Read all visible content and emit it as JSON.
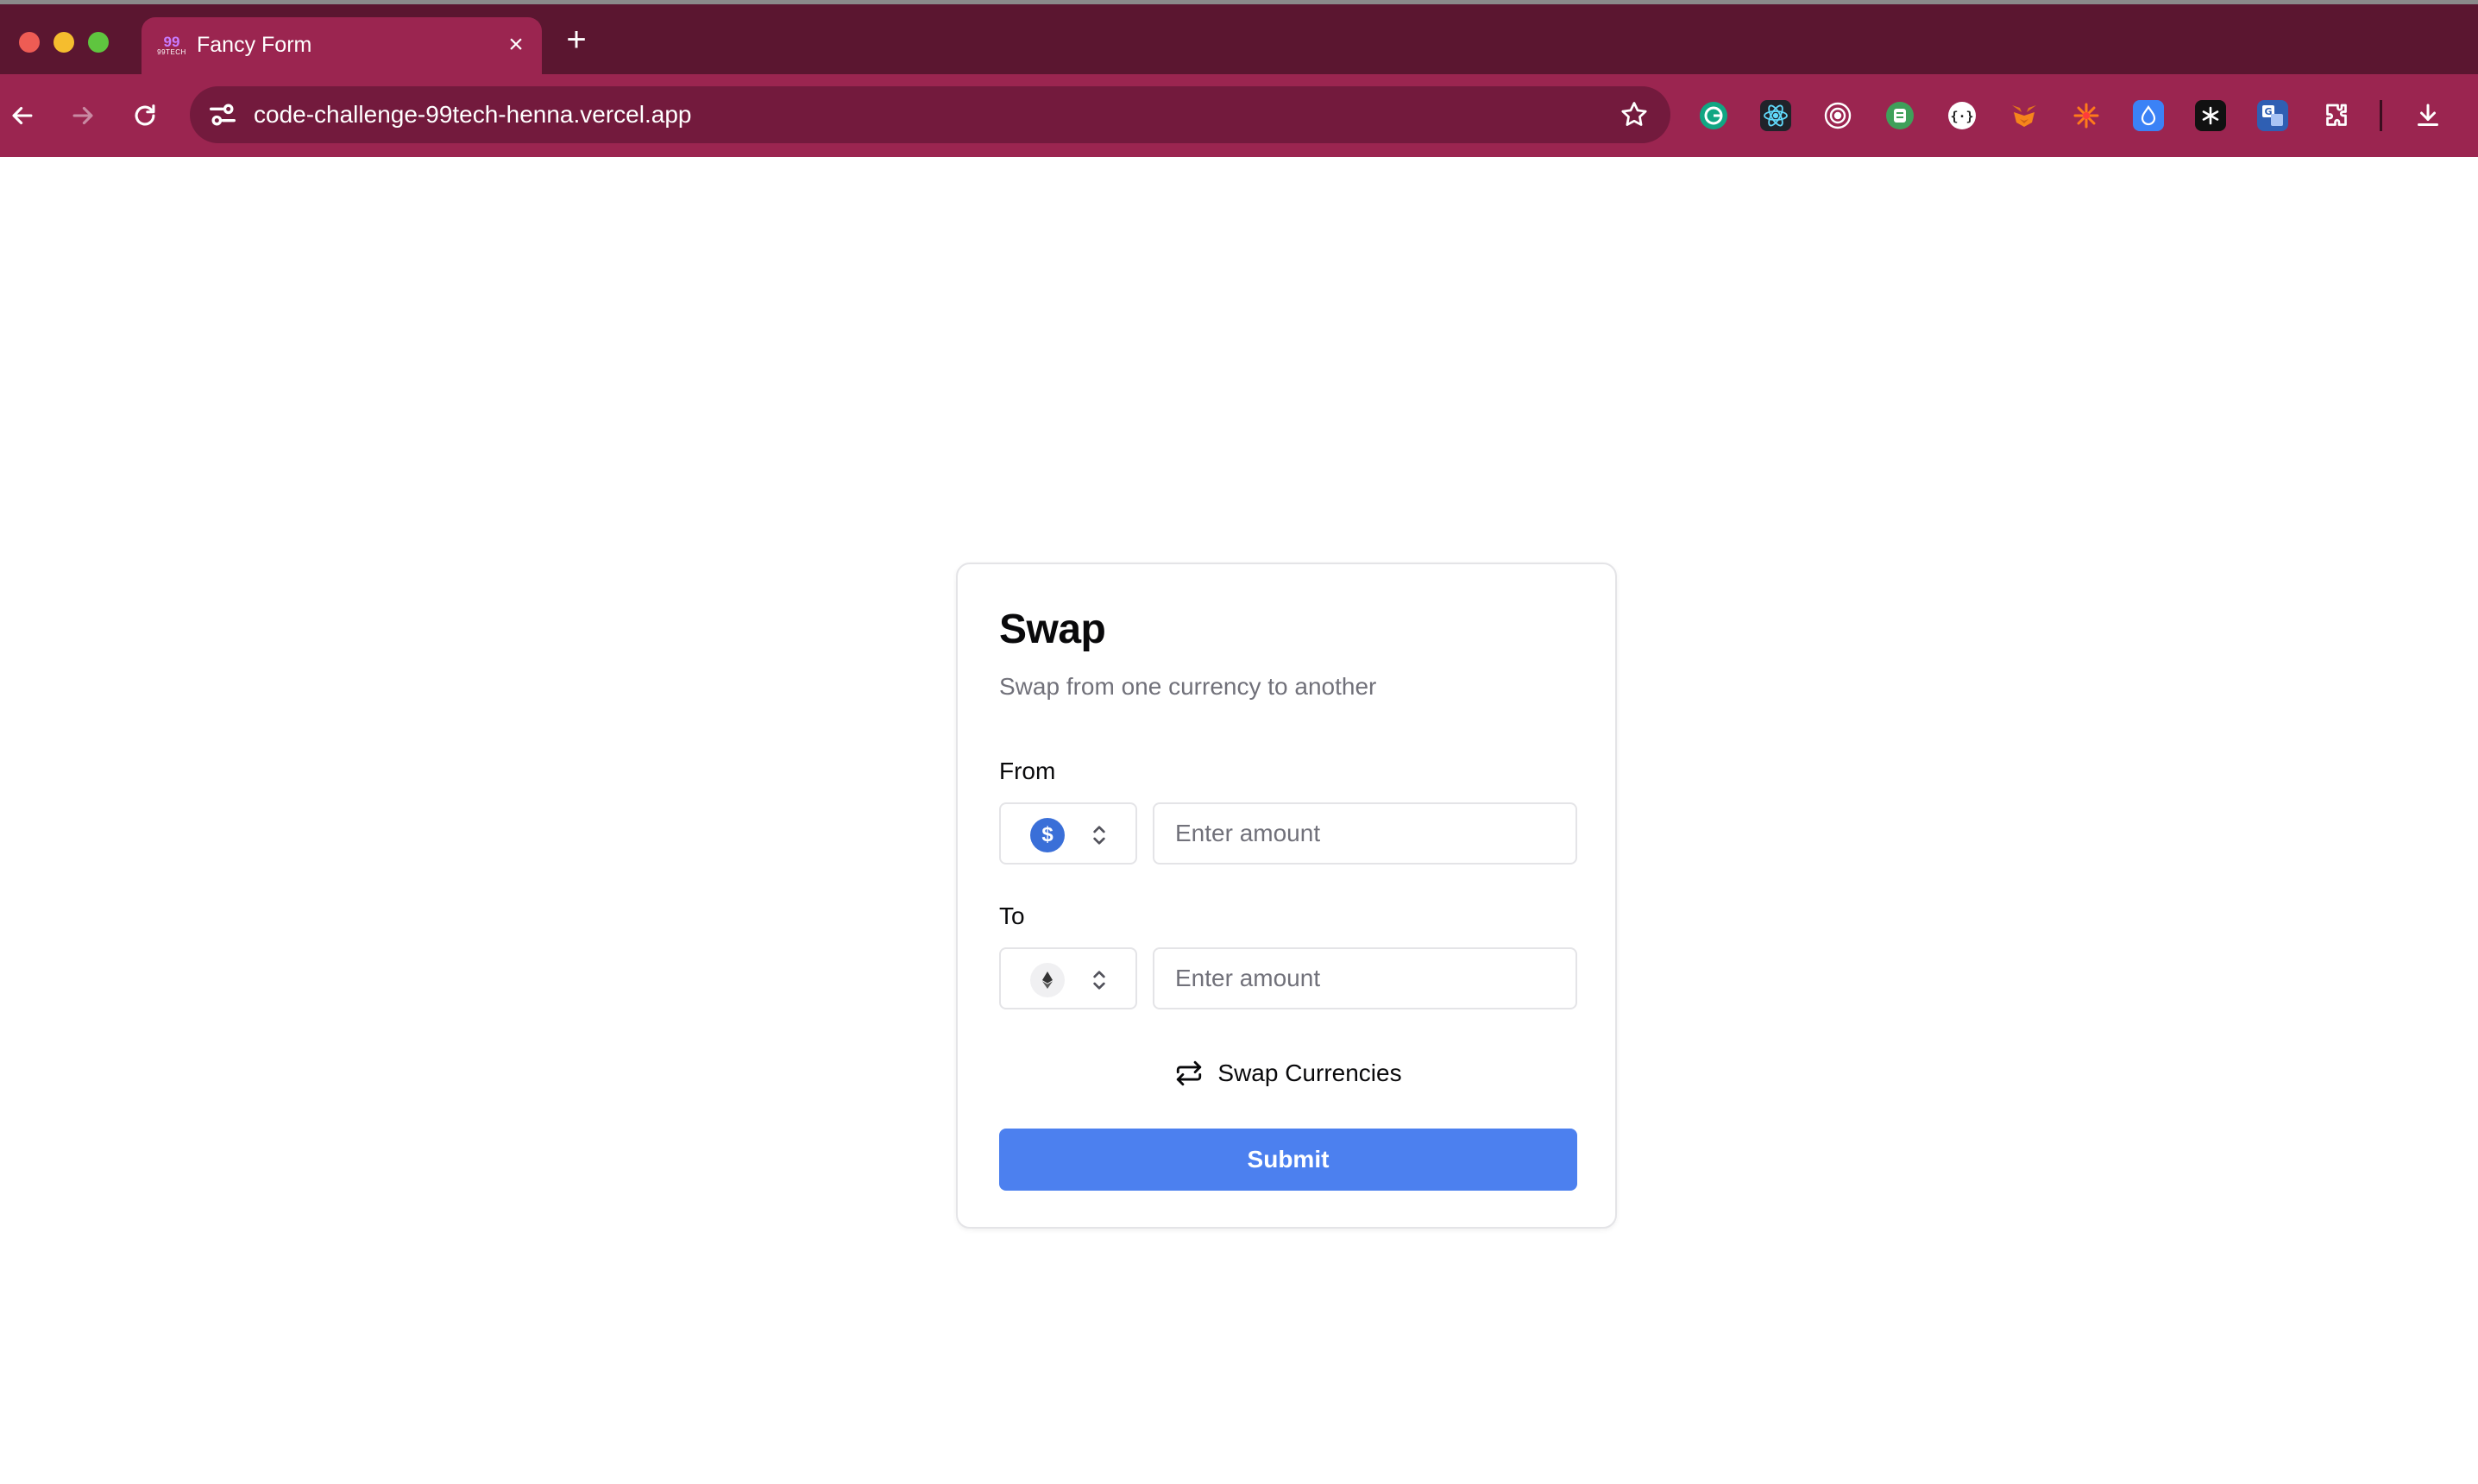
{
  "browser": {
    "tab": {
      "title": "Fancy Form",
      "favicon_text_top": "99",
      "favicon_text_bottom": "99TECH"
    },
    "address_bar": {
      "url": "code-challenge-99tech-henna.vercel.app"
    },
    "toolbar_icons": [
      "back-icon",
      "forward-icon",
      "reload-icon",
      "site-settings-icon",
      "bookmark-star-icon",
      "extensions-puzzle-icon",
      "download-icon"
    ],
    "extensions": [
      "grammarly-icon",
      "react-devtools-icon",
      "target-icon",
      "green-extension-icon",
      "json-viewer-icon",
      "metamask-icon",
      "burst-icon",
      "blue-drop-icon",
      "dark-asterisk-icon",
      "translate-icon"
    ]
  },
  "swap_form": {
    "title": "Swap",
    "description": "Swap from one currency to another",
    "from": {
      "label": "From",
      "currency_icon": "usd-coin-icon",
      "amount_placeholder": "Enter amount",
      "amount_value": ""
    },
    "to": {
      "label": "To",
      "currency_icon": "ethereum-icon",
      "amount_placeholder": "Enter amount",
      "amount_value": ""
    },
    "swap_button_label": "Swap Currencies",
    "submit_label": "Submit"
  },
  "colors": {
    "tabstrip": "#5b1630",
    "toolbar": "#9b2550",
    "omnibox": "#731a3d",
    "primary": "#4c80ef",
    "muted_text": "#71717a",
    "border": "#e4e4e7"
  }
}
